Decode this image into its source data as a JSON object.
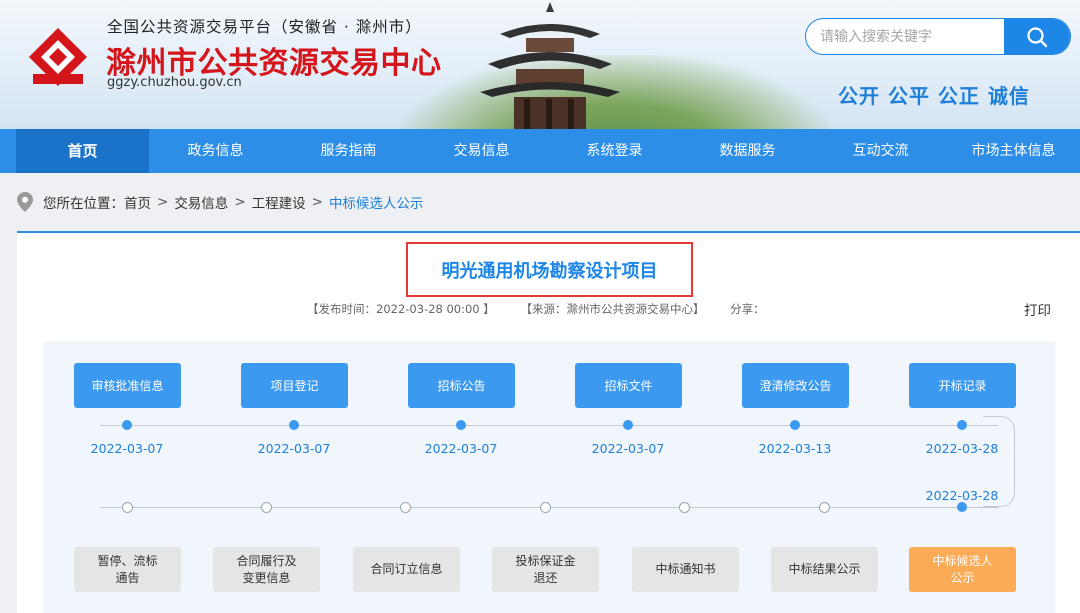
{
  "header": {
    "subtitle": "全国公共资源交易平台（安徽省 · 滁州市）",
    "title": "滁州市公共资源交易中心",
    "url": "ggzy.chuzhou.gov.cn",
    "search_placeholder": "请输入搜索关键字",
    "slogan": "公开 公平 公正 诚信"
  },
  "nav": [
    "首页",
    "政务信息",
    "服务指南",
    "交易信息",
    "系统登录",
    "数据服务",
    "互动交流",
    "市场主体信息"
  ],
  "breadcrumb": {
    "prefix": "您所在位置：",
    "items": [
      "首页",
      "交易信息",
      "工程建设"
    ],
    "current": "中标候选人公示",
    "separator": ">"
  },
  "article": {
    "title": "明光通用机场勘察设计项目",
    "publish_time": "【发布时间：2022-03-28 00:00 】",
    "source": "【来源：滁州市公共资源交易中心】",
    "share": "分享：",
    "print": "打印"
  },
  "flow": {
    "top_steps": [
      {
        "label": "审核批准信息",
        "date": "2022-03-07"
      },
      {
        "label": "项目登记",
        "date": "2022-03-07"
      },
      {
        "label": "招标公告",
        "date": "2022-03-07"
      },
      {
        "label": "招标文件",
        "date": "2022-03-07"
      },
      {
        "label": "澄清修改公告",
        "date": "2022-03-13"
      },
      {
        "label": "开标记录",
        "date": "2022-03-28"
      }
    ],
    "bottom_date": "2022-03-28",
    "bottom_steps": [
      "暂停、流标\n通告",
      "合同履行及\n变更信息",
      "合同订立信息",
      "投标保证金\n退还",
      "中标通知书",
      "中标结果公示",
      "中标候选人\n公示"
    ],
    "active_bottom": "中标候选人\n公示"
  },
  "colors": {
    "primary": "#2d8ee8",
    "nav_active": "#1a72c9",
    "title_red": "#d4161c",
    "highlight": "#e53935",
    "active_step": "#fbaa56"
  }
}
